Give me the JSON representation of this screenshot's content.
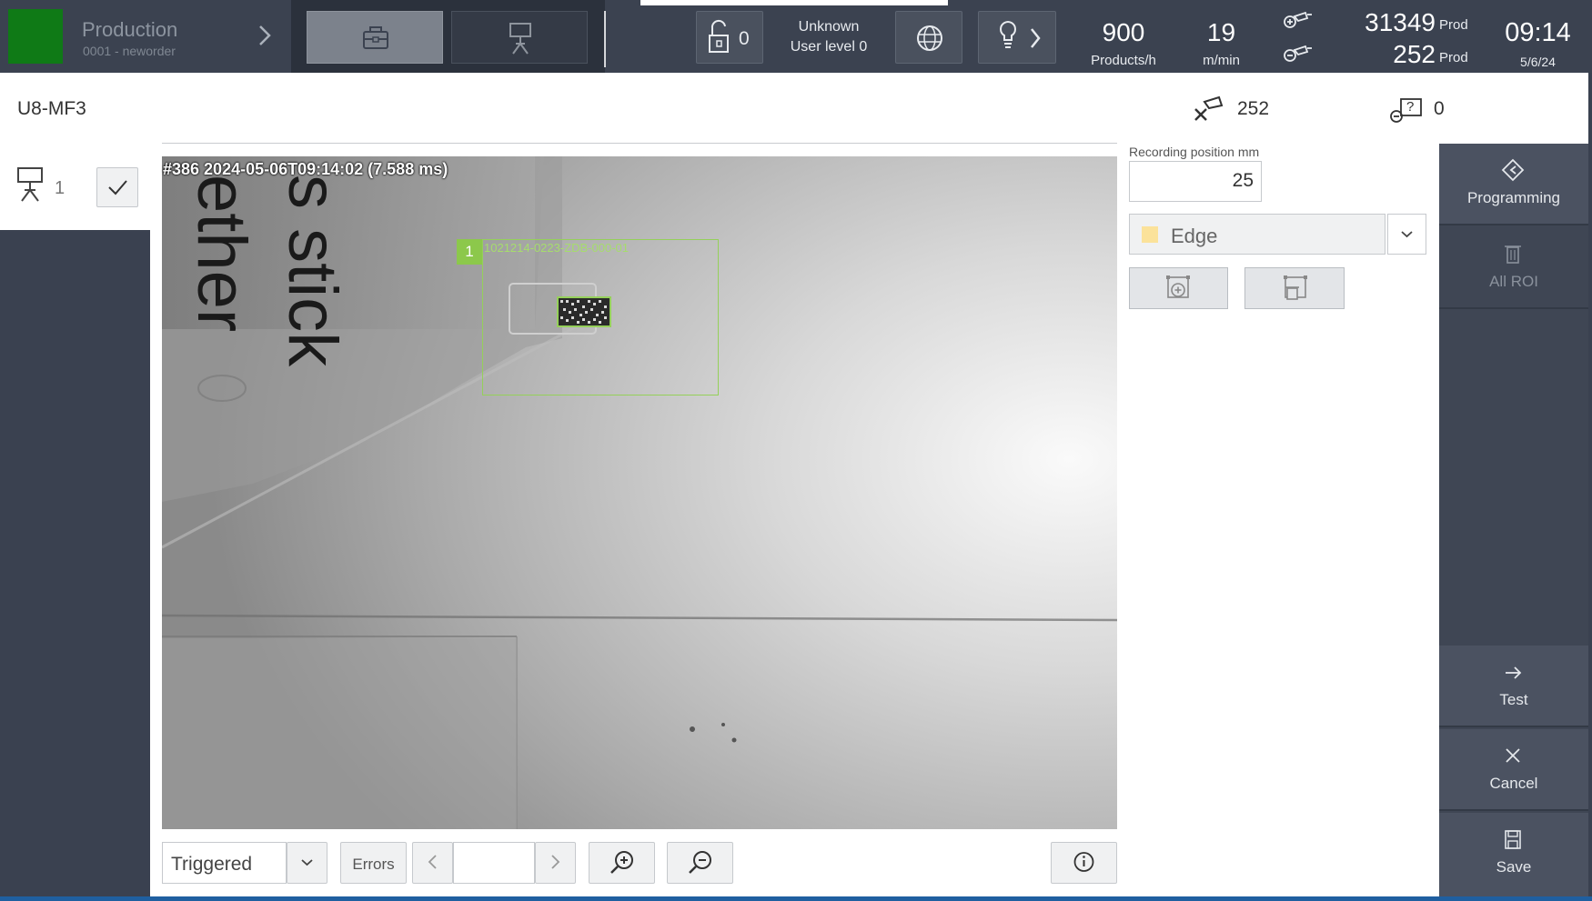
{
  "topbar": {
    "production_title": "Production",
    "production_order": "0001 - neworder",
    "lock_count": "0",
    "user_name": "Unknown",
    "user_level": "User level 0",
    "speed_value": "900",
    "speed_unit": "Products/h",
    "meter_value": "19",
    "meter_unit": "m/min",
    "counter_good_value": "31349",
    "counter_good_unit": "Prod",
    "counter_bad_value": "252",
    "counter_bad_unit": "Prod",
    "clock_time": "09:14",
    "clock_date": "5/6/24",
    "status_color": "#0f7a16"
  },
  "header": {
    "station_name": "U8-MF3",
    "reject_count": "252",
    "unknown_count": "0"
  },
  "left_panel": {
    "camera_count": "1"
  },
  "image": {
    "caption": "#386 2024-05-06T09:14:02 (7.588 ms)",
    "roi_index": "1",
    "roi_code": "1021214-0223-ZDB-000-01",
    "background_text": "s stick\nether"
  },
  "toolbar": {
    "mode": "Triggered",
    "errors_label": "Errors",
    "page_value": ""
  },
  "settings": {
    "recording_position_label": "Recording position mm",
    "recording_position_value": "25",
    "roi_type": "Edge",
    "roi_type_color": "#fbe29a"
  },
  "sidebar": {
    "programming": "Programming",
    "all_roi": "All ROI",
    "test": "Test",
    "cancel": "Cancel",
    "save": "Save"
  },
  "icons": {
    "briefcase": "briefcase-icon",
    "camera": "camera-icon",
    "lock": "lock-icon",
    "globe": "globe-icon",
    "lightbulb": "lightbulb-icon",
    "reject": "reject-icon",
    "unknown": "unknown-icon"
  }
}
